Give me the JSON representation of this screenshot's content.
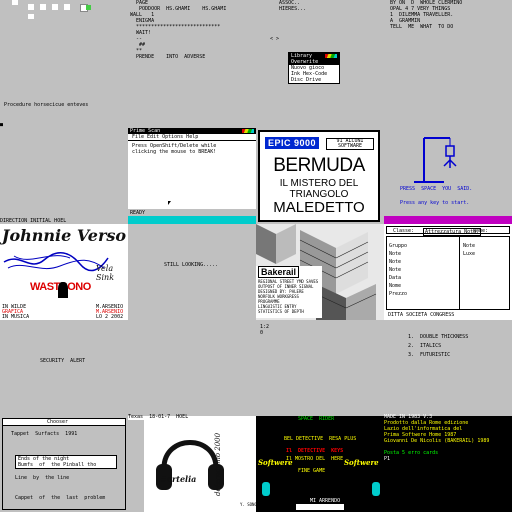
{
  "r1": {
    "t1": {
      "lines": [
        "   1 2 3",
        "          (1)",
        "  0 ",
        ""
      ]
    },
    "t2": {
      "lines": [
        "  PAGE",
        "   PODDOOR  HS.GHAMI    HS.GHAMI",
        "WALL   1",
        "  ENIGMA",
        "  ****************************",
        "",
        "  WAIT!",
        "",
        "  --",
        "   ##",
        "  **",
        "  PRENDE    INTO  ADVERSE"
      ]
    },
    "t3": {
      "lines": [
        "     ASSOC..",
        "     HIERES...",
        "     ",
        "     ",
        "     ",
        "     ",
        "  < >"
      ]
    },
    "t4": {
      "lines": [
        "",
        "",
        "",
        "",
        "",
        "  BY ON  D  WHOLE CLERMINO",
        "  OPAL 4 7 VERY THINGS",
        "  1  DILEMMA TRAVELLER.",
        "  A  GRAMMIN",
        "  TELL  ME  WHAT  TO DO"
      ]
    }
  },
  "r2": {
    "t1": {
      "lines": [
        "Procedure horsecicue enteves"
      ]
    },
    "menu": {
      "title": "Library",
      "items": [
        "Overwrite",
        "Nuovo gioco",
        "Ink Hex-Code",
        "Disc Drive"
      ]
    },
    "t4": {
      "lines": []
    }
  },
  "r3": {
    "t1": {
      "caption": "DIRECTION INITIAL HOEL"
    },
    "t2": {
      "title": "Prime Scan",
      "menu": "File Edit Options Help",
      "body": [
        "Press OpenShift/Delete while",
        "clicking the mouse to BREAK!"
      ],
      "footer": "READY"
    },
    "t3": {
      "tag": "EPIC 9000",
      "sub": "91 ALCUNI SOFTWARE",
      "title": "BERMUDA",
      "line2": "IL MISTERO DEL",
      "line3": "TRIANGOLO",
      "line4": "MALEDETTO"
    },
    "t4": {
      "l1": "PRESS  SPACE  YOU  SAID.",
      "l2": "Press any key to start."
    }
  },
  "r4": {
    "t1": {
      "name": "Johnnie Verso",
      "logo": "WASTRONO",
      "rows": [
        "IN WILDE",
        "GRAFICA",
        "IN MUSICA"
      ],
      "right": [
        "M.ARSENIO",
        "M.ARSENIO",
        "LO 2 2002"
      ]
    },
    "t2": {
      "text": "STILL LOOKING....."
    },
    "t3": {
      "brand": "Bakerail",
      "rows": [
        "REGIONAL STREET YMD SAVES",
        "OUTPOST OF INNER SIGNAL",
        "DESIGNED BY: PALERE",
        "NORFOLK WORKGRESS",
        "PROGRAMME",
        "LINGUISTIC ENTRY",
        "STATISTICS OF DEPTH"
      ]
    },
    "t4": {
      "labels": [
        "Classe:",
        "Attrezzatura Nota:",
        "Nome:"
      ],
      "fields": [
        "Gruppo",
        "Note",
        "Note",
        "Note",
        "Data",
        "Nome",
        "Prezzo",
        "Note",
        "Luxe"
      ],
      "footer": "DITTA SOCIETA CONGRESS"
    }
  },
  "r5": {
    "t1": {
      "text": "SECURITY  ALERT"
    },
    "t3": {
      "lines": [
        "1:2",
        "0"
      ]
    },
    "t4": {
      "lines": [
        "1.  DOUBLE THICKNESS",
        "2.  ITALICS",
        "3.  FUTURISTIC"
      ]
    }
  },
  "r6": {
    "t1": {
      "title": "Chooser",
      "rows": [
        "Tappet  Surfacts  1991",
        "Ends of the night",
        "Bumfs  of  the Pinball tho",
        "Line  by  the line",
        "Cappet  of  the  last  problem"
      ]
    },
    "t2": {
      "caption": "Texas  18-01-7  HOEL",
      "brand": "#ortelia",
      "side": "deferndumo 2000",
      "footer": "Y. SONG GOODS"
    },
    "t3": {
      "title": "SPACE  RIDER",
      "rows": [
        "BEL DETECTIVE  RESA PLUS",
        "Il  DETECTIVE  KEYS",
        "Il MOSTRO DEL  HERE",
        "FINE GAME",
        "Softwere",
        "Softwere",
        "DISKETTE MANAGEMENT"
      ],
      "footer": "MI ARRENDO"
    },
    "t4": {
      "lines": [
        "MADE IN 1983 V.3",
        "Prodotto dalla Rome edizione",
        "Lazio dell'informatica del",
        "Prima Softwere Home 1987",
        "Giovanni De Nicolis (BAKERAIL) 1989",
        "",
        "Posta 5 erro cards",
        "P1"
      ]
    }
  }
}
